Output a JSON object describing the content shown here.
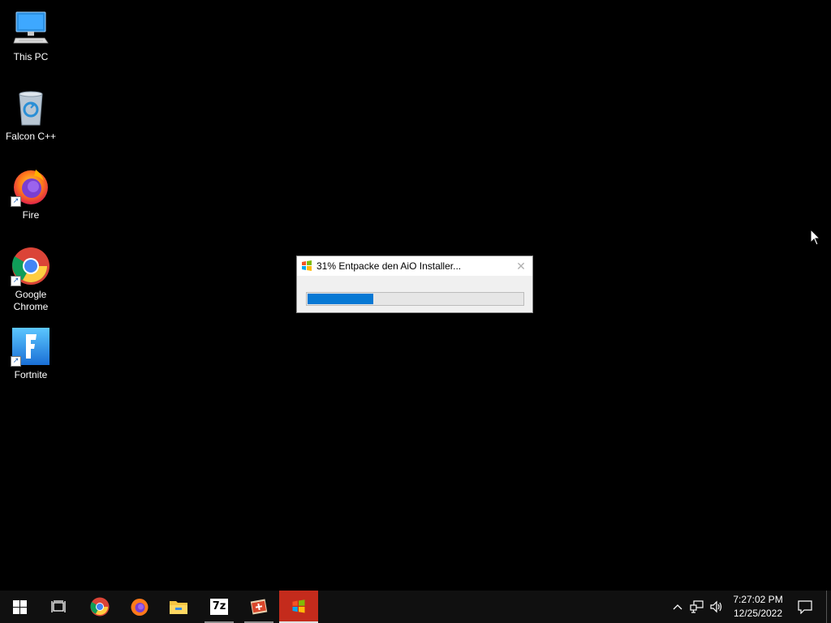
{
  "desktop": {
    "icons": [
      {
        "label": "This PC",
        "icon": "this-pc-icon",
        "shortcut": false
      },
      {
        "label": "Falcon C++",
        "icon": "recycle-bin-icon",
        "shortcut": false
      },
      {
        "label": "Fire",
        "icon": "firefox-icon",
        "shortcut": true
      },
      {
        "label": "Google Chrome",
        "icon": "chrome-icon",
        "shortcut": true
      },
      {
        "label": "Fortnite",
        "icon": "fortnite-icon",
        "shortcut": true
      }
    ]
  },
  "dialog": {
    "title": "31% Entpacke den AiO Installer...",
    "close_symbol": "✕",
    "progress_percent": 31
  },
  "taskbar": {
    "apps": [
      {
        "name": "start-button",
        "icon": "windows-logo-icon"
      },
      {
        "name": "task-view-button",
        "icon": "task-view-icon"
      },
      {
        "name": "taskbar-chrome",
        "icon": "chrome-icon"
      },
      {
        "name": "taskbar-firefox",
        "icon": "firefox-icon"
      },
      {
        "name": "taskbar-file-explorer",
        "icon": "folder-icon"
      },
      {
        "name": "taskbar-7zip",
        "icon": "7zip-icon",
        "label": "7z"
      },
      {
        "name": "taskbar-installer-app",
        "icon": "installer-icon"
      },
      {
        "name": "taskbar-aio-installer",
        "icon": "windows-flag-icon"
      }
    ],
    "tray": {
      "chevron": "^",
      "icons": [
        "network-icon",
        "volume-icon",
        "action-center-icon"
      ]
    },
    "clock": {
      "time": "7:27:02 PM",
      "date": "12/25/2022"
    }
  },
  "colors": {
    "desktop_background": "#000000",
    "taskbar_background": "#101010",
    "progress_fill": "#0678d4",
    "active_task_highlight": "#c42b1c"
  }
}
